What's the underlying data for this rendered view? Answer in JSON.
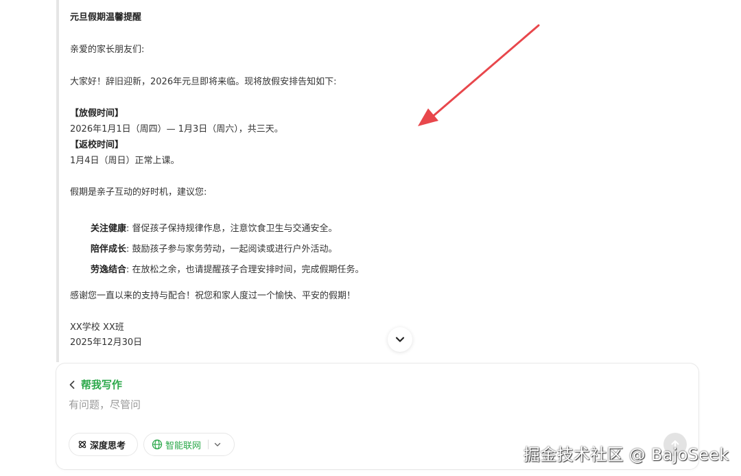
{
  "note": {
    "title": "元旦假期温馨提醒",
    "greeting": "亲爱的家长朋友们:",
    "intro": "大家好！辞旧迎新，2026年元旦即将来临。现将放假安排告知如下:",
    "holiday_heading": "【放假时间】",
    "holiday_text": "2026年1月1日（周四）— 1月3日（周六），共三天。",
    "return_heading": "【返校时间】",
    "return_text": "1月4日（周日）正常上课。",
    "suggestion_intro": "假期是亲子互动的好时机，建议您:",
    "items": [
      {
        "label": "关注健康",
        "text": ": 督促孩子保持规律作息，注意饮食卫生与交通安全。"
      },
      {
        "label": "陪伴成长",
        "text": ": 鼓励孩子参与家务劳动，一起阅读或进行户外活动。"
      },
      {
        "label": "劳逸结合",
        "text": ": 在放松之余，也请提醒孩子合理安排时间，完成假期任务。"
      }
    ],
    "closing": "感谢您一直以来的支持与配合！祝您和家人度过一个愉快、平安的假期！",
    "signature": "XX学校 XX班",
    "date": "2025年12月30日"
  },
  "composer": {
    "mode_label": "帮我写作",
    "placeholder": "有问题，尽管问",
    "deep_think_label": "深度思考",
    "web_search_label": "智能联网"
  },
  "watermark": "掘金技术社区 @ BajoSeek",
  "colors": {
    "accent_green": "#2ba84a",
    "arrow_red": "#e8474c",
    "quote_border": "#e5e5e5"
  },
  "icons": {
    "back": "chevron-left-icon",
    "deep_think": "atom-icon",
    "web": "globe-icon",
    "dropdown": "chevron-down-icon",
    "scroll": "chevron-down-icon",
    "send": "arrow-up-icon"
  }
}
